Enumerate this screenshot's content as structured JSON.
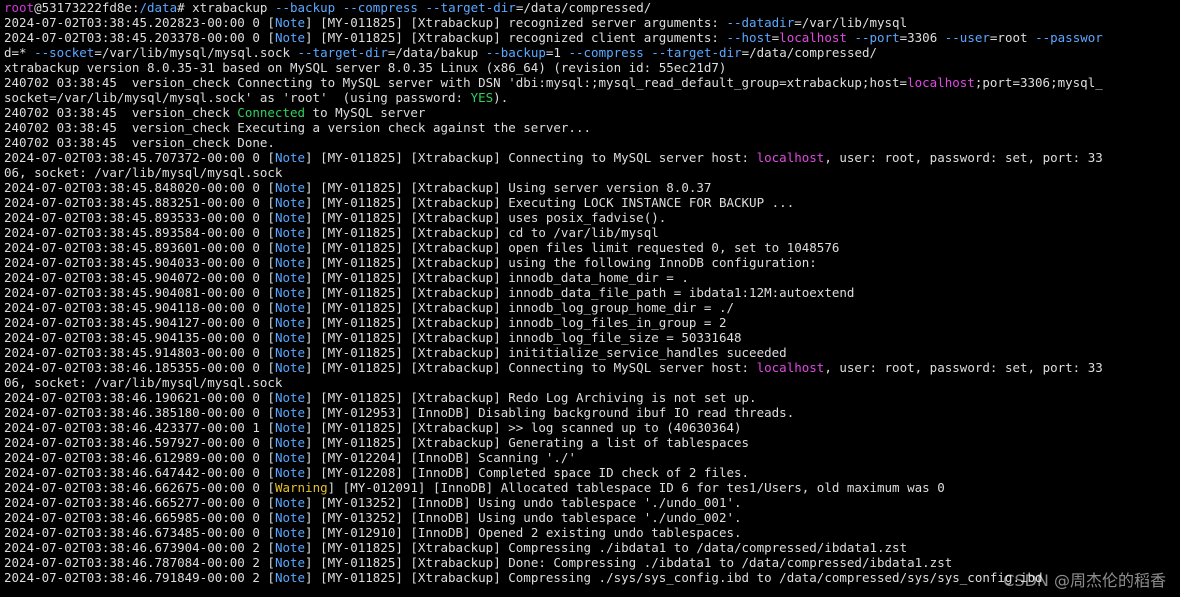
{
  "terminal": {
    "lines": [
      {
        "kind": "prompt",
        "user": "root",
        "host": "@53173222fd8e",
        "sep": ":",
        "path": "/data",
        "end": "# ",
        "cmd": "xtrabackup ",
        "args": [
          [
            "--backup",
            "",
            " "
          ],
          [
            "--compress",
            "",
            " "
          ],
          [
            "--target-dir",
            "=/data/compressed/",
            ""
          ]
        ]
      },
      {
        "kind": "log",
        "text": "2024-07-02T03:38:45.202823-00:00 0 [Note] [MY-011825] [Xtrabackup] recognized server arguments: --datadir=/var/lib/mysql"
      },
      {
        "kind": "log",
        "text": "2024-07-02T03:38:45.203378-00:00 0 [Note] [MY-011825] [Xtrabackup] recognized client arguments: --host=localhost --port=3306 --user=root --passwor"
      },
      {
        "kind": "log",
        "text": "d=* --socket=/var/lib/mysql/mysql.sock --target-dir=/data/bakup --backup=1 --compress --target-dir=/data/compressed/"
      },
      {
        "kind": "log",
        "text": "xtrabackup version 8.0.35-31 based on MySQL server 8.0.35 Linux (x86_64) (revision id: 55ec21d7)"
      },
      {
        "kind": "log",
        "text": "240702 03:38:45  version_check Connecting to MySQL server with DSN 'dbi:mysql:;mysql_read_default_group=xtrabackup;host=localhost;port=3306;mysql_"
      },
      {
        "kind": "log",
        "text": "socket=/var/lib/mysql/mysql.sock' as 'root'  (using password: YES)."
      },
      {
        "kind": "log",
        "text": "240702 03:38:45  version_check Connected to MySQL server"
      },
      {
        "kind": "log",
        "text": "240702 03:38:45  version_check Executing a version check against the server..."
      },
      {
        "kind": "log",
        "text": "240702 03:38:45  version_check Done."
      },
      {
        "kind": "log",
        "text": "2024-07-02T03:38:45.707372-00:00 0 [Note] [MY-011825] [Xtrabackup] Connecting to MySQL server host: localhost, user: root, password: set, port: 33"
      },
      {
        "kind": "log",
        "text": "06, socket: /var/lib/mysql/mysql.sock"
      },
      {
        "kind": "log",
        "text": "2024-07-02T03:38:45.848020-00:00 0 [Note] [MY-011825] [Xtrabackup] Using server version 8.0.37"
      },
      {
        "kind": "log",
        "text": "2024-07-02T03:38:45.883251-00:00 0 [Note] [MY-011825] [Xtrabackup] Executing LOCK INSTANCE FOR BACKUP ..."
      },
      {
        "kind": "log",
        "text": "2024-07-02T03:38:45.893533-00:00 0 [Note] [MY-011825] [Xtrabackup] uses posix_fadvise()."
      },
      {
        "kind": "log",
        "text": "2024-07-02T03:38:45.893584-00:00 0 [Note] [MY-011825] [Xtrabackup] cd to /var/lib/mysql"
      },
      {
        "kind": "log",
        "text": "2024-07-02T03:38:45.893601-00:00 0 [Note] [MY-011825] [Xtrabackup] open files limit requested 0, set to 1048576"
      },
      {
        "kind": "log",
        "text": "2024-07-02T03:38:45.904033-00:00 0 [Note] [MY-011825] [Xtrabackup] using the following InnoDB configuration:"
      },
      {
        "kind": "log",
        "text": "2024-07-02T03:38:45.904072-00:00 0 [Note] [MY-011825] [Xtrabackup] innodb_data_home_dir = ."
      },
      {
        "kind": "log",
        "text": "2024-07-02T03:38:45.904081-00:00 0 [Note] [MY-011825] [Xtrabackup] innodb_data_file_path = ibdata1:12M:autoextend"
      },
      {
        "kind": "log",
        "text": "2024-07-02T03:38:45.904118-00:00 0 [Note] [MY-011825] [Xtrabackup] innodb_log_group_home_dir = ./"
      },
      {
        "kind": "log",
        "text": "2024-07-02T03:38:45.904127-00:00 0 [Note] [MY-011825] [Xtrabackup] innodb_log_files_in_group = 2"
      },
      {
        "kind": "log",
        "text": "2024-07-02T03:38:45.904135-00:00 0 [Note] [MY-011825] [Xtrabackup] innodb_log_file_size = 50331648"
      },
      {
        "kind": "log",
        "text": "2024-07-02T03:38:45.914803-00:00 0 [Note] [MY-011825] [Xtrabackup] inititialize_service_handles suceeded"
      },
      {
        "kind": "log",
        "text": "2024-07-02T03:38:46.185355-00:00 0 [Note] [MY-011825] [Xtrabackup] Connecting to MySQL server host: localhost, user: root, password: set, port: 33"
      },
      {
        "kind": "log",
        "text": "06, socket: /var/lib/mysql/mysql.sock"
      },
      {
        "kind": "log",
        "text": "2024-07-02T03:38:46.190621-00:00 0 [Note] [MY-011825] [Xtrabackup] Redo Log Archiving is not set up."
      },
      {
        "kind": "log",
        "text": "2024-07-02T03:38:46.385180-00:00 0 [Note] [MY-012953] [InnoDB] Disabling background ibuf IO read threads."
      },
      {
        "kind": "log",
        "text": "2024-07-02T03:38:46.423377-00:00 1 [Note] [MY-011825] [Xtrabackup] >> log scanned up to (40630364)"
      },
      {
        "kind": "log",
        "text": "2024-07-02T03:38:46.597927-00:00 0 [Note] [MY-011825] [Xtrabackup] Generating a list of tablespaces"
      },
      {
        "kind": "log",
        "text": "2024-07-02T03:38:46.612989-00:00 0 [Note] [MY-012204] [InnoDB] Scanning './'"
      },
      {
        "kind": "log",
        "text": "2024-07-02T03:38:46.647442-00:00 0 [Note] [MY-012208] [InnoDB] Completed space ID check of 2 files."
      },
      {
        "kind": "log",
        "text": "2024-07-02T03:38:46.662675-00:00 0 [Warning] [MY-012091] [InnoDB] Allocated tablespace ID 6 for tes1/Users, old maximum was 0"
      },
      {
        "kind": "log",
        "text": "2024-07-02T03:38:46.665277-00:00 0 [Note] [MY-013252] [InnoDB] Using undo tablespace './undo_001'."
      },
      {
        "kind": "log",
        "text": "2024-07-02T03:38:46.665985-00:00 0 [Note] [MY-013252] [InnoDB] Using undo tablespace './undo_002'."
      },
      {
        "kind": "log",
        "text": "2024-07-02T03:38:46.673485-00:00 0 [Note] [MY-012910] [InnoDB] Opened 2 existing undo tablespaces."
      },
      {
        "kind": "log",
        "text": "2024-07-02T03:38:46.673904-00:00 2 [Note] [MY-011825] [Xtrabackup] Compressing ./ibdata1 to /data/compressed/ibdata1.zst"
      },
      {
        "kind": "log",
        "text": "2024-07-02T03:38:46.787084-00:00 2 [Note] [MY-011825] [Xtrabackup] Done: Compressing ./ibdata1 to /data/compressed/ibdata1.zst"
      },
      {
        "kind": "log",
        "text": "2024-07-02T03:38:46.791849-00:00 2 [Note] [MY-011825] [Xtrabackup] Compressing ./sys/sys_config.ibd to /data/compressed/sys/sys_config.ibd"
      }
    ]
  },
  "watermark": "CSDN @周杰伦的稻香",
  "colors": {
    "note": "#5aa8ff",
    "warning": "#e3c02b",
    "host": "#e04ae0",
    "ok": "#2fd15c",
    "prompt_user": "#d03bd8"
  }
}
